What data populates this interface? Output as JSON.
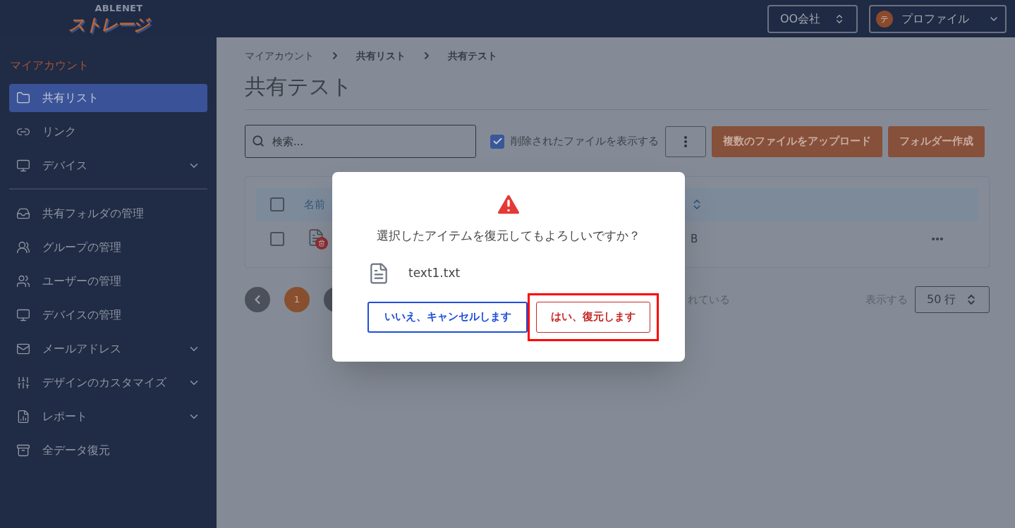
{
  "logo": {
    "brand": "ABLENET",
    "product": "ストレージ"
  },
  "header": {
    "company_select": "OO会社",
    "profile": {
      "initial": "テ",
      "label": "プロファイル"
    }
  },
  "sidebar": {
    "section_title": "マイアカウント",
    "groups": [
      [
        {
          "label": "共有リスト",
          "selected": true,
          "expandable": false
        },
        {
          "label": "リンク",
          "selected": false,
          "expandable": false
        },
        {
          "label": "デバイス",
          "selected": false,
          "expandable": true
        }
      ],
      [
        {
          "label": "共有フォルダの管理",
          "selected": false,
          "expandable": false
        },
        {
          "label": "グループの管理",
          "selected": false,
          "expandable": false
        },
        {
          "label": "ユーザーの管理",
          "selected": false,
          "expandable": false
        },
        {
          "label": "デバイスの管理",
          "selected": false,
          "expandable": false
        },
        {
          "label": "メールアドレス",
          "selected": false,
          "expandable": true
        },
        {
          "label": "デザインのカスタマイズ",
          "selected": false,
          "expandable": true
        },
        {
          "label": "レポート",
          "selected": false,
          "expandable": true
        },
        {
          "label": "全データ復元",
          "selected": false,
          "expandable": false
        }
      ]
    ]
  },
  "breadcrumb": [
    "マイアカウント",
    "共有リスト",
    "共有テスト"
  ],
  "page_title": "共有テスト",
  "toolbar": {
    "search": {
      "placeholder": "検索..."
    },
    "show_deleted": {
      "label": "削除されたファイルを表示する",
      "checked": true
    },
    "buttons": [
      "複数のファイルをアップロード",
      "フォルダー作成"
    ]
  },
  "table": {
    "all_checked": false,
    "columns": [
      {
        "label": "名前"
      }
    ],
    "rows": [
      {
        "checked": false,
        "deleted": true,
        "column_3": "B"
      }
    ]
  },
  "pagination": {
    "pages": [
      {
        "label": "1",
        "selected": true
      }
    ],
    "status": "れている",
    "rows_label": "表示する",
    "rows_per_page": "50 行"
  },
  "dialog": {
    "message": "選択したアイテムを復元してもよろしいですか？",
    "file": "text1.txt",
    "cancel": "いいえ、キャンセルします",
    "confirm": "はい、復元します",
    "confirm_highlighted": true
  }
}
